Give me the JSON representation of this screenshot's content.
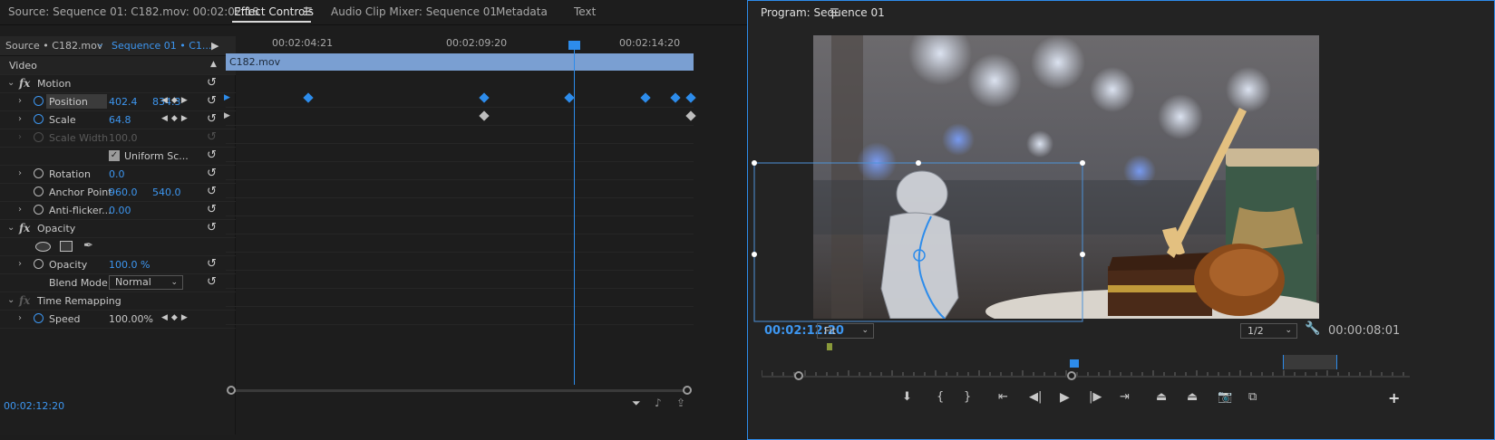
{
  "tabs": {
    "source": "Source: Sequence 01: C182.mov: 00:02:02:18",
    "effect_controls": "Effect Controls",
    "audio_mixer": "Audio Clip Mixer: Sequence 01",
    "metadata": "Metadata",
    "text": "Text"
  },
  "effect_controls": {
    "source_tab": "Source • C182.mov",
    "sequence_tab": "Sequence 01 • C1...",
    "video_label": "Video",
    "clip_name": "C182.mov",
    "ruler": [
      "00:02:04:21",
      "00:02:09:20",
      "00:02:14:20"
    ],
    "motion": "Motion",
    "position": {
      "label": "Position",
      "x": "402.4",
      "y": "834.3"
    },
    "scale": {
      "label": "Scale",
      "value": "64.8"
    },
    "scale_width": {
      "label": "Scale Width",
      "value": "100.0"
    },
    "uniform_scale": "Uniform Sc...",
    "rotation": {
      "label": "Rotation",
      "value": "0.0"
    },
    "anchor_point": {
      "label": "Anchor Point",
      "x": "960.0",
      "y": "540.0"
    },
    "anti_flicker": {
      "label": "Anti-flicker...",
      "value": "0.00"
    },
    "opacity_group": "Opacity",
    "opacity": {
      "label": "Opacity",
      "value": "100.0 %"
    },
    "blend_mode": {
      "label": "Blend Mode",
      "value": "Normal"
    },
    "time_remapping": "Time Remapping",
    "speed": {
      "label": "Speed",
      "value": "100.00%"
    },
    "timecode": "00:02:12:20"
  },
  "program": {
    "title": "Program: Sequence 01",
    "timecode": "00:02:12:20",
    "duration": "00:00:08:01",
    "zoom": "Fit",
    "resolution": "1/2"
  },
  "colors": {
    "accent": "#2d8ceb",
    "panel": "#1d1d1d",
    "clip": "#7a9fd2"
  }
}
